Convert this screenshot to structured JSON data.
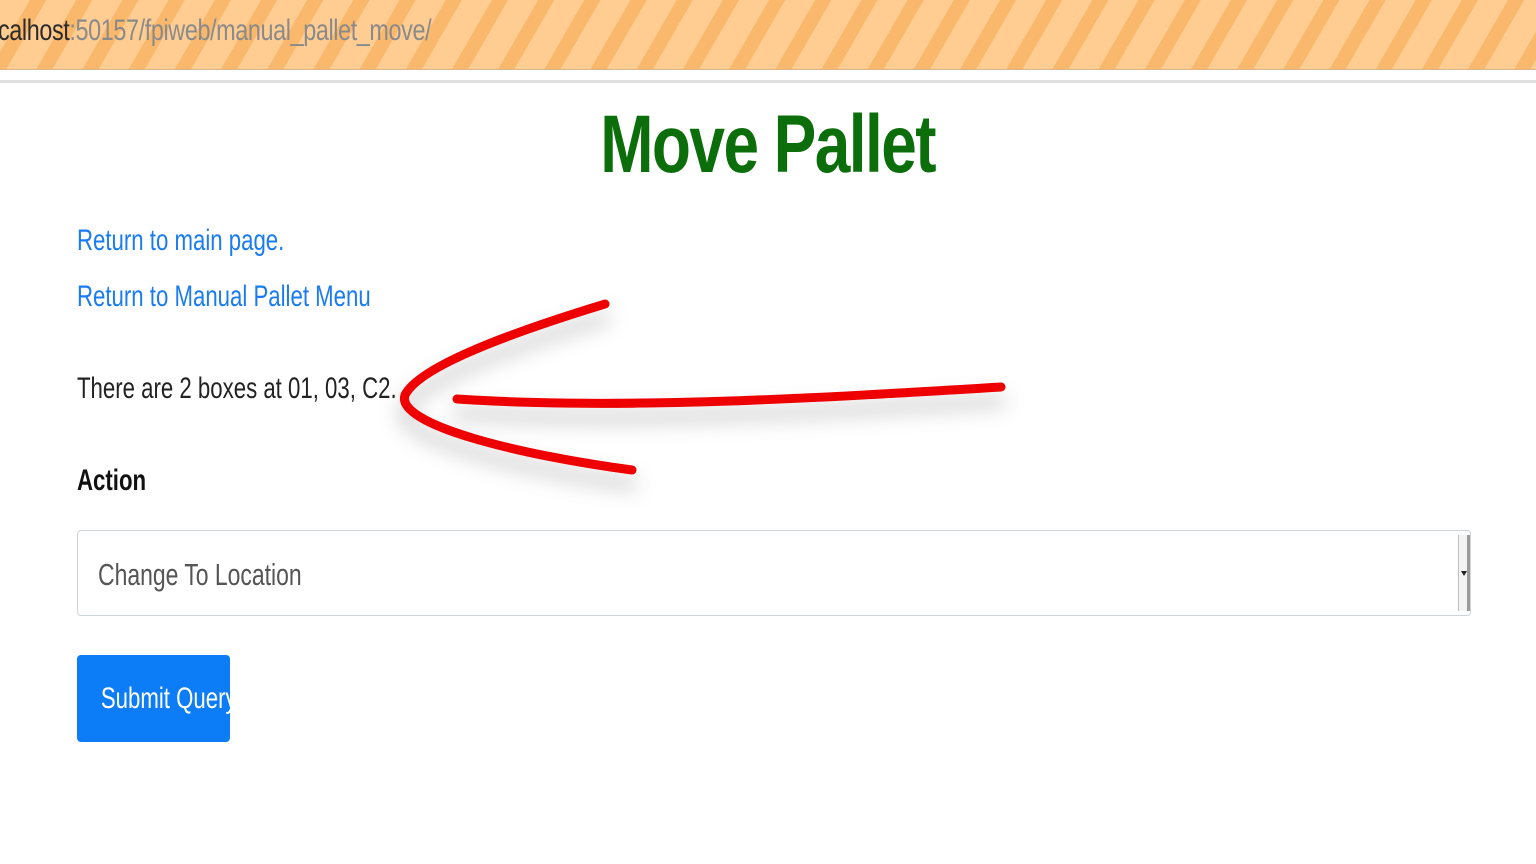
{
  "browser": {
    "url_host": "calhost",
    "url_rest": ":50157/fpiweb/manual_pallet_move/"
  },
  "page": {
    "title": "Move Pallet",
    "links": {
      "main_page": "Return to main page.",
      "pallet_menu": "Return to Manual Pallet Menu"
    },
    "status_text": "There are 2 boxes at 01, 03, C2.",
    "form": {
      "action_label": "Action",
      "action_selected": "Change To Location",
      "submit_label": "Submit Query"
    }
  },
  "colors": {
    "title": "#0b6e0b",
    "link": "#1a7cf0",
    "button": "#0d7cf7",
    "annotation_arrow": "#ee0000"
  },
  "icons": {
    "annotation": "red-arrow-pointing-left",
    "select": "dropdown-caret"
  }
}
